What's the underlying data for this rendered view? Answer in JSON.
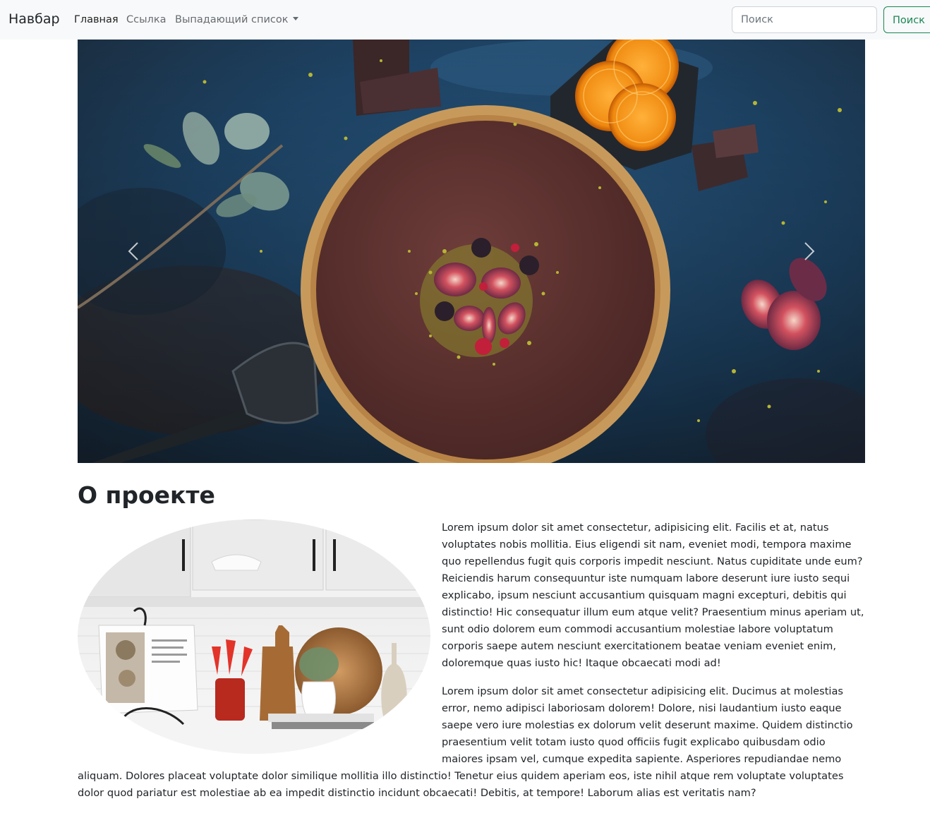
{
  "navbar": {
    "brand": "Навбар",
    "links": [
      {
        "label": "Главная",
        "active": true
      },
      {
        "label": "Ссылка",
        "active": false
      },
      {
        "label": "Выпадающий список",
        "active": false,
        "dropdown": true
      }
    ],
    "search_placeholder": "Поиск",
    "search_button": "Поиск",
    "accent_color": "#198754"
  },
  "carousel": {
    "prev_icon": "chevron-left-icon",
    "next_icon": "chevron-right-icon"
  },
  "about": {
    "title": "О проекте",
    "paragraphs": [
      "Lorem ipsum dolor sit amet consectetur, adipisicing elit. Facilis et at, natus voluptates nobis mollitia. Eius eligendi sit nam, eveniet modi, tempora maxime quo repellendus fugit quis corporis impedit nesciunt. Natus cupiditate unde eum? Reiciendis harum consequuntur iste numquam labore deserunt iure iusto sequi explicabo, ipsum nesciunt accusantium quisquam magni excepturi, debitis qui distinctio! Hic consequatur illum eum atque velit? Praesentium minus aperiam ut, sunt odio dolorem eum commodi accusantium molestiae labore voluptatum corporis saepe autem nesciunt exercitationem beatae veniam eveniet enim, doloremque quas iusto hic! Itaque obcaecati modi ad!",
      "Lorem ipsum dolor sit amet consectetur adipisicing elit. Ducimus at molestias error, nemo adipisci laboriosam dolorem! Dolore, nisi laudantium iusto eaque saepe vero iure molestias ex dolorum velit deserunt maxime. Quidem distinctio praesentium velit totam iusto quod officiis fugit explicabo quibusdam odio maiores ipsam vel, cumque expedita sapiente. Asperiores repudiandae nemo aliquam. Dolores placeat voluptate dolor similique mollitia illo distinctio! Tenetur eius quidem aperiam eos, iste nihil atque rem voluptate voluptates dolor quod pariatur est molestiae ab ea impedit distinctio incidunt obcaecati! Debitis, at tempore! Laborum alias est veritatis nam?"
    ]
  }
}
